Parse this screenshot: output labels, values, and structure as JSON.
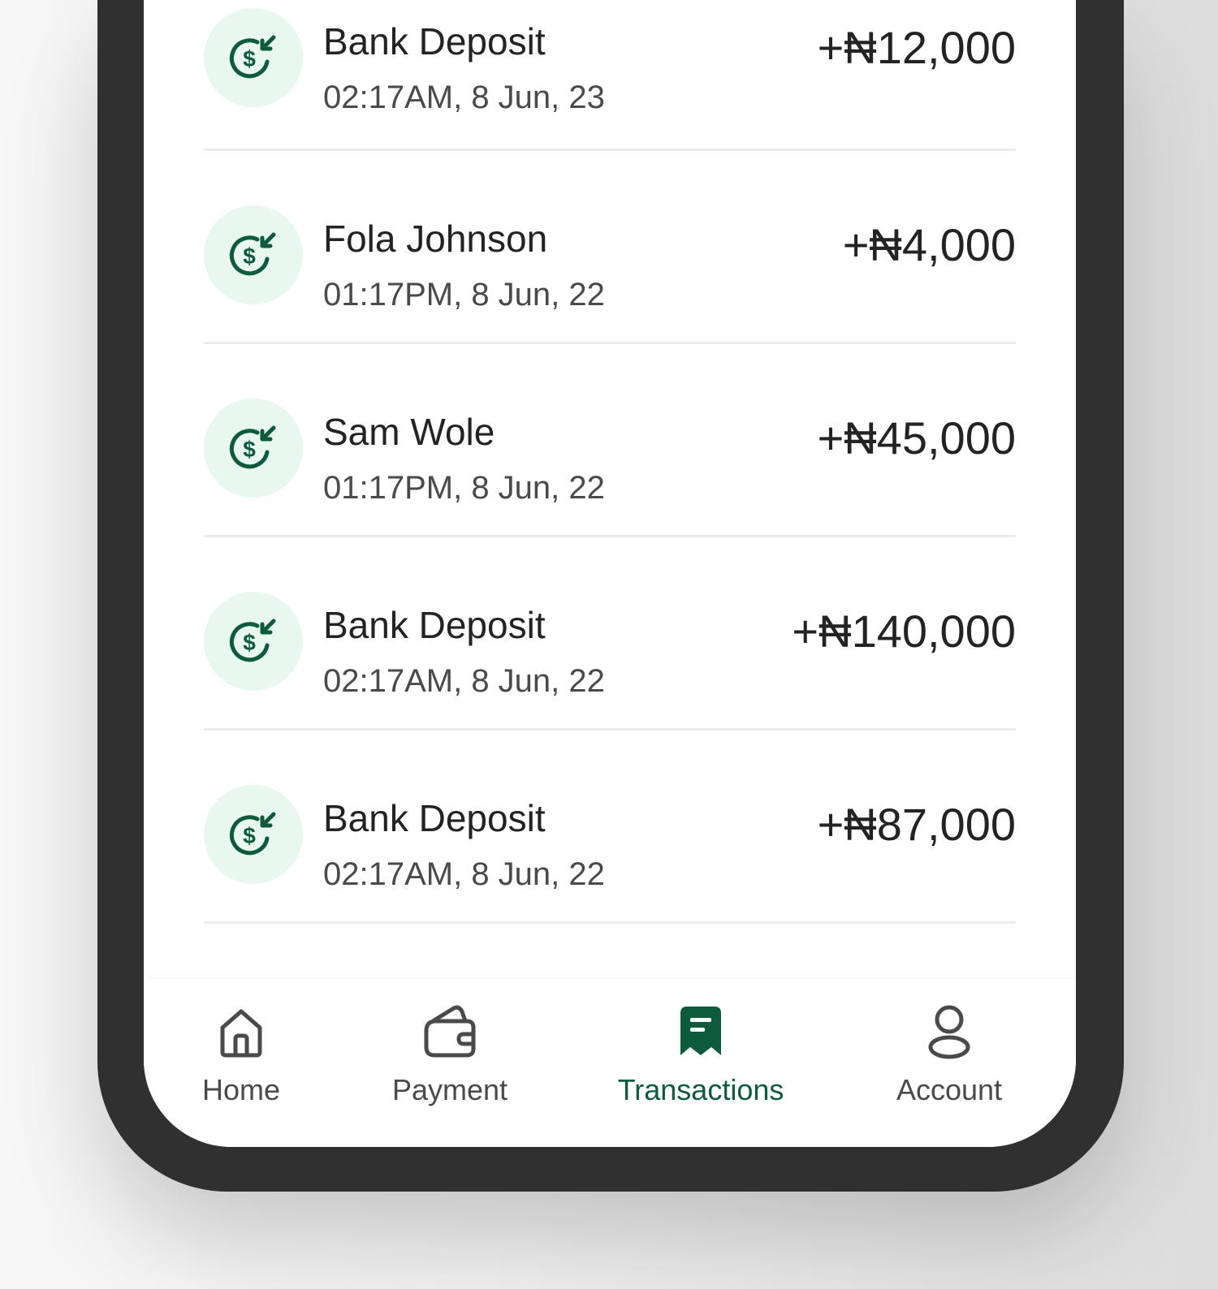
{
  "colors": {
    "accent": "#0e5a3d",
    "icon_bg": "#e8f8f1",
    "frame": "#303030"
  },
  "transactions": [
    {
      "name": "Bank Deposit",
      "time": "02:17AM, 8 Jun, 23",
      "amount": "+₦12,000",
      "icon": "dollar-receive-icon"
    },
    {
      "name": "Fola Johnson",
      "time": "01:17PM, 8 Jun, 22",
      "amount": "+₦4,000",
      "icon": "dollar-receive-icon"
    },
    {
      "name": "Sam Wole",
      "time": "01:17PM, 8 Jun, 22",
      "amount": "+₦45,000",
      "icon": "dollar-receive-icon"
    },
    {
      "name": "Bank Deposit",
      "time": "02:17AM, 8 Jun, 22",
      "amount": "+₦140,000",
      "icon": "dollar-receive-icon"
    },
    {
      "name": "Bank Deposit",
      "time": "02:17AM, 8 Jun, 22",
      "amount": "+₦87,000",
      "icon": "dollar-receive-icon"
    }
  ],
  "nav": {
    "items": [
      {
        "label": "Home",
        "icon": "home-icon"
      },
      {
        "label": "Payment",
        "icon": "wallet-icon"
      },
      {
        "label": "Transactions",
        "icon": "receipt-icon",
        "active": true
      },
      {
        "label": "Account",
        "icon": "user-icon"
      }
    ]
  }
}
